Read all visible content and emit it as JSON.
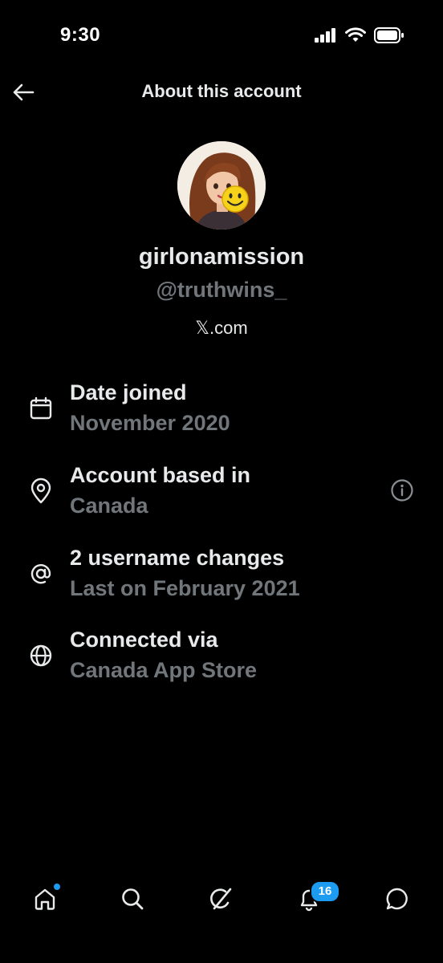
{
  "status_bar": {
    "time": "9:30",
    "icons": [
      "signal-icon",
      "wifi-icon",
      "battery-icon"
    ]
  },
  "header": {
    "title": "About this account",
    "back_icon": "arrow-left-icon"
  },
  "profile": {
    "display_name": "girlonamission",
    "handle": "@truthwins_",
    "platform": "𝕏.com"
  },
  "info_rows": [
    {
      "icon": "calendar-icon",
      "title": "Date joined",
      "value": "November 2020"
    },
    {
      "icon": "location-pin-icon",
      "title": "Account based in",
      "value": "Canada",
      "has_info": true
    },
    {
      "icon": "at-sign-icon",
      "title": "2 username changes",
      "value": "Last on February 2021"
    },
    {
      "icon": "globe-icon",
      "title": "Connected via",
      "value": "Canada App Store"
    }
  ],
  "bottom_nav": {
    "items": [
      "home-icon",
      "search-icon",
      "grok-icon",
      "notifications-icon",
      "messages-icon"
    ],
    "notification_count": "16"
  },
  "colors": {
    "background": "#000000",
    "primary_text": "#e7e9ea",
    "secondary_text": "#71767b",
    "accent": "#1d9bf0"
  }
}
